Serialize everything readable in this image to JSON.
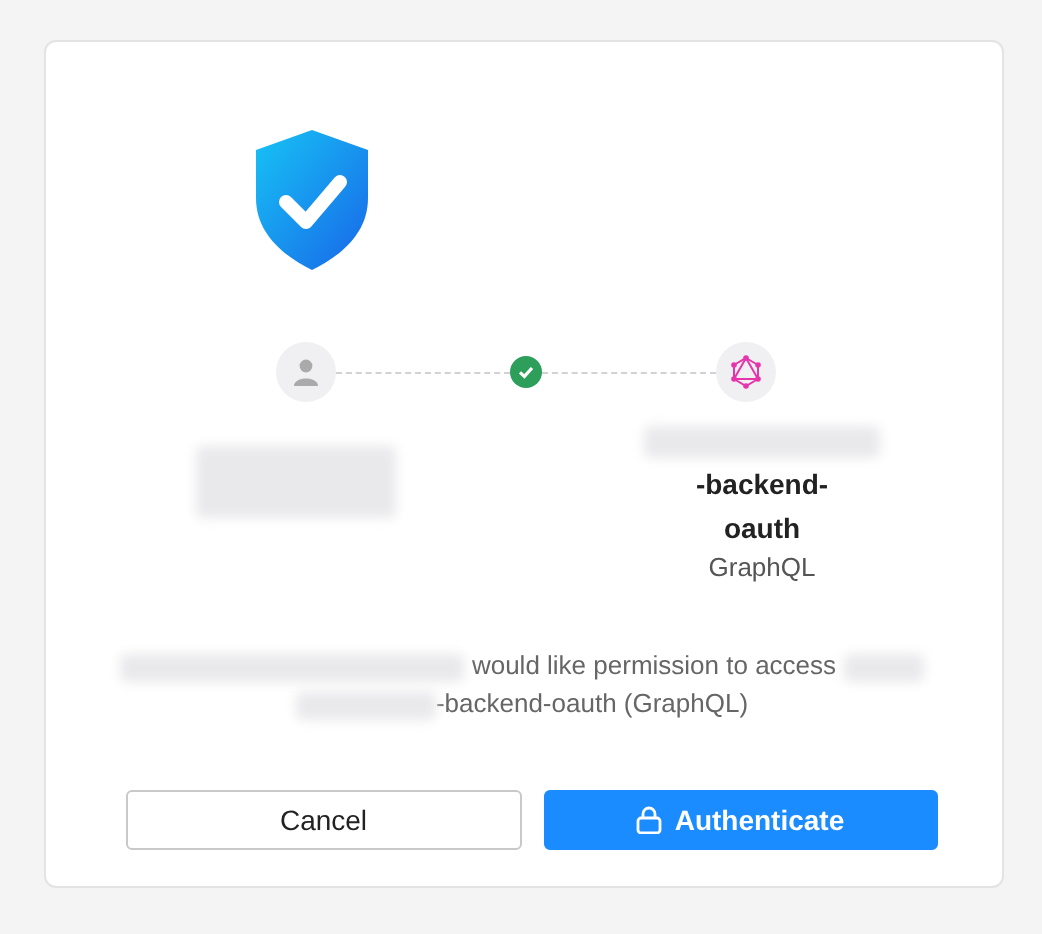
{
  "app": {
    "name": "-backend-oauth",
    "type": "GraphQL"
  },
  "message": {
    "text": "would like permission to access",
    "target": "-backend-oauth (GraphQL)"
  },
  "buttons": [
    {
      "label": "Cancel",
      "kind": "secondary"
    },
    {
      "label": "Authenticate",
      "kind": "primary"
    }
  ]
}
